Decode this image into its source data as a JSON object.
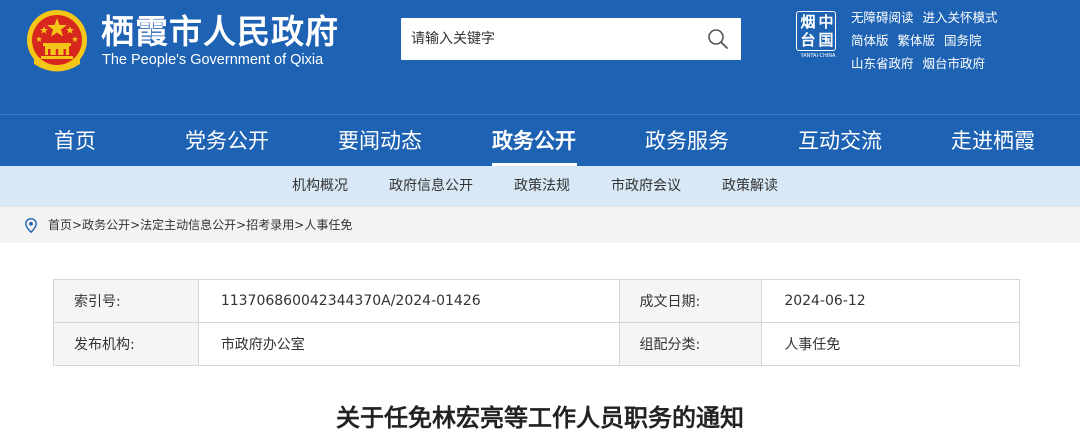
{
  "header": {
    "title_cn": "栖霞市人民政府",
    "title_en": "The People's Government of Qixia",
    "emblem_icon": "national-emblem-icon"
  },
  "search": {
    "placeholder": "请输入关键字",
    "icon": "search-icon"
  },
  "logo": {
    "chars": [
      "烟",
      "中",
      "台",
      "国"
    ],
    "sub": "YANTAI·CHINA"
  },
  "toplinks": {
    "row1": [
      "无障碍阅读",
      "进入关怀模式"
    ],
    "row2": [
      "简体版",
      "繁体版",
      "国务院"
    ],
    "row3": [
      "山东省政府",
      "烟台市政府"
    ]
  },
  "nav": {
    "items": [
      "首页",
      "党务公开",
      "要闻动态",
      "政务公开",
      "政务服务",
      "互动交流",
      "走进栖霞"
    ],
    "active": "政务公开"
  },
  "subnav": {
    "items": [
      "机构概况",
      "政府信息公开",
      "政策法规",
      "市政府会议",
      "政策解读"
    ]
  },
  "breadcrumb": {
    "icon": "location-pin-icon",
    "items": [
      "首页",
      "政务公开",
      "法定主动信息公开",
      "招考录用",
      "人事任免"
    ],
    "separator": ">"
  },
  "meta": {
    "index_label": "索引号:",
    "index_value": "113706860042344370A/2024-01426",
    "date_label": "成文日期:",
    "date_value": "2024-06-12",
    "publisher_label": "发布机构:",
    "publisher_value": "市政府办公室",
    "category_label": "组配分类:",
    "category_value": "人事任免"
  },
  "article": {
    "title": "关于任免林宏亮等工作人员职务的通知"
  },
  "colors": {
    "header_blue": "#1e62b4",
    "subnav_bg": "#d9e8f7",
    "breadcrumb_bg": "#f3f3f3",
    "emblem_red": "#d7261e",
    "emblem_gold": "#f5c518"
  }
}
